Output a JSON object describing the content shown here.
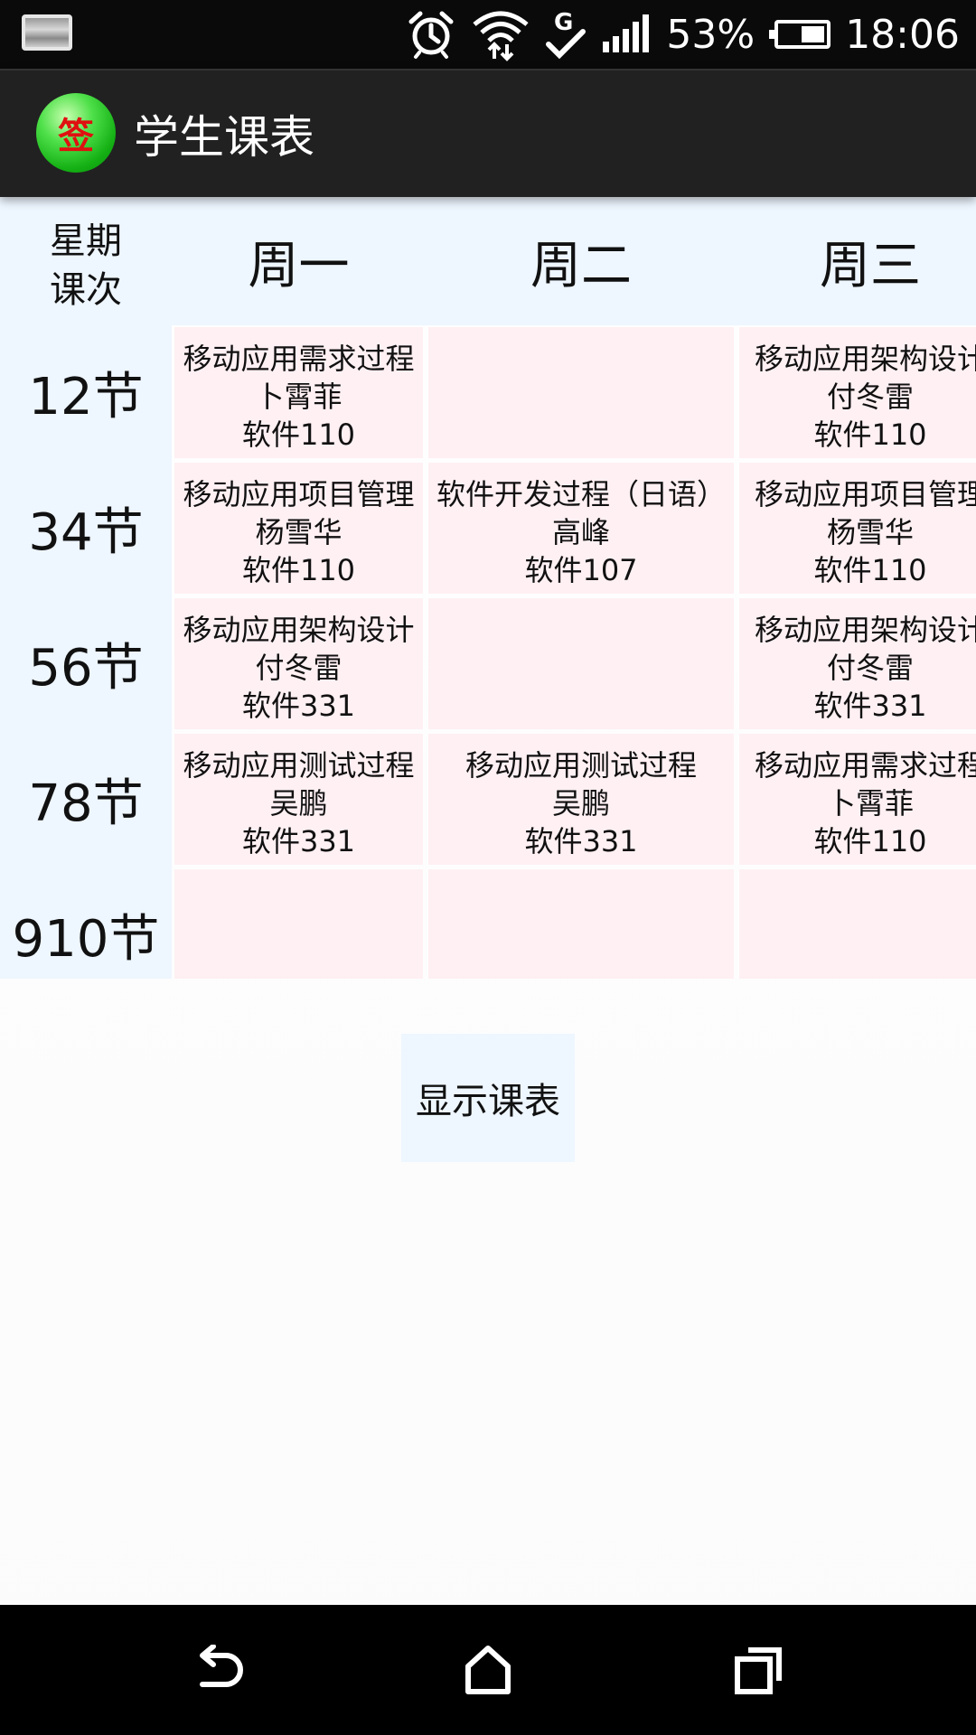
{
  "status_bar": {
    "battery_percent": "53%",
    "battery_level": 0.53,
    "time": "18:06",
    "icons": [
      "notification-image-icon",
      "alarm-icon",
      "wifi-icon",
      "data-sync-check-icon",
      "signal-icon",
      "battery-icon"
    ]
  },
  "action_bar": {
    "app_icon_glyph": "签",
    "title": "学生课表"
  },
  "timetable": {
    "corner_top": "星期",
    "corner_bottom": "课次",
    "days": [
      "周一",
      "周二",
      "周三"
    ],
    "periods": [
      "12节",
      "34节",
      "56节",
      "78节",
      "910节"
    ],
    "cells": [
      [
        {
          "course": "移动应用需求过程",
          "teacher": "卜霄菲",
          "room": "软件110"
        },
        {
          "course": "",
          "teacher": "",
          "room": ""
        },
        {
          "course": "移动应用架构设计",
          "teacher": "付冬雷",
          "room": "软件110"
        }
      ],
      [
        {
          "course": "移动应用项目管理",
          "teacher": "杨雪华",
          "room": "软件110"
        },
        {
          "course": "软件开发过程（日语）",
          "teacher": "高峰",
          "room": "软件107"
        },
        {
          "course": "移动应用项目管理",
          "teacher": "杨雪华",
          "room": "软件110"
        }
      ],
      [
        {
          "course": "移动应用架构设计",
          "teacher": "付冬雷",
          "room": "软件331"
        },
        {
          "course": "",
          "teacher": "",
          "room": ""
        },
        {
          "course": "移动应用架构设计",
          "teacher": "付冬雷",
          "room": "软件331"
        }
      ],
      [
        {
          "course": "移动应用测试过程",
          "teacher": "吴鹏",
          "room": "软件331"
        },
        {
          "course": "移动应用测试过程",
          "teacher": "吴鹏",
          "room": "软件331"
        },
        {
          "course": "移动应用需求过程",
          "teacher": "卜霄菲",
          "room": "软件110"
        }
      ],
      [
        {
          "course": "",
          "teacher": "",
          "room": ""
        },
        {
          "course": "",
          "teacher": "",
          "room": ""
        },
        {
          "course": "",
          "teacher": "",
          "room": ""
        }
      ]
    ]
  },
  "show_button": {
    "label": "显示课表"
  },
  "nav_bar": {
    "icons": [
      "back-icon",
      "home-icon",
      "recents-icon"
    ]
  },
  "colors": {
    "status_bar_bg": "#0a0a0a",
    "action_bar_bg": "#212121",
    "header_bg": "#eef6ff",
    "cell_bg": "#fff0f3",
    "nav_bar_bg": "#000000"
  }
}
